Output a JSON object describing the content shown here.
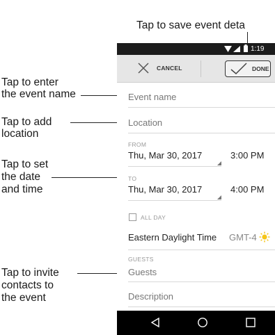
{
  "callouts": {
    "save": "Tap to save event deta",
    "name_line1": "Tap to enter",
    "name_line2": "the event name",
    "location_line1": "Tap to add",
    "location_line2": "location",
    "datetime_line1": "Tap to set",
    "datetime_line2": "the date",
    "datetime_line3": "and time",
    "guests_line1": "Tap to invite",
    "guests_line2": "contacts to",
    "guests_line3": "the event"
  },
  "status_bar": {
    "time": "1:19"
  },
  "toolbar": {
    "cancel_label": "CANCEL",
    "done_label": "DONE"
  },
  "form": {
    "event_name_placeholder": "Event name",
    "location_placeholder": "Location",
    "from_label": "FROM",
    "from_date": "Thu, Mar 30, 2017",
    "from_time": "3:00 PM",
    "to_label": "TO",
    "to_date": "Thu, Mar 30, 2017",
    "to_time": "4:00 PM",
    "all_day_label": "ALL DAY",
    "timezone": "Eastern Daylight Time",
    "timezone_offset": "GMT-4",
    "guests_label": "GUESTS",
    "guests_placeholder": "Guests",
    "description_placeholder": "Description"
  },
  "icons": {
    "cancel": "close-icon",
    "done": "check-icon",
    "timezone": "sun-icon",
    "nav_back": "back-triangle-icon",
    "nav_home": "home-circle-icon",
    "nav_recents": "recents-square-icon"
  },
  "colors": {
    "sun": "#f5c518",
    "status_bar": "#1c1c1c",
    "toolbar": "#e6e6e6"
  }
}
